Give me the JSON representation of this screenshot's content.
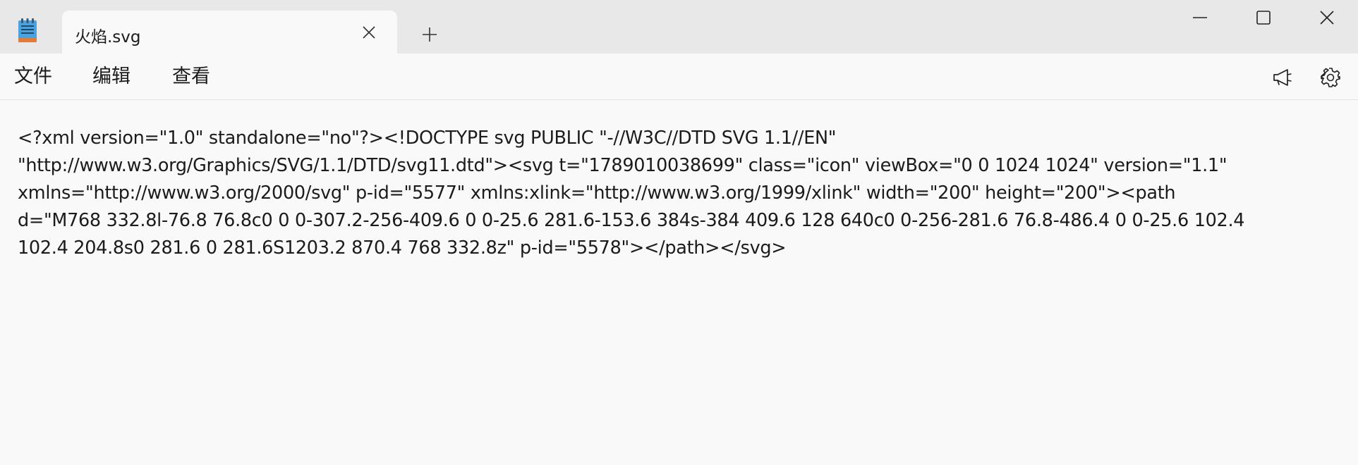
{
  "tab": {
    "title": "火焰.svg"
  },
  "menu": {
    "file": "文件",
    "edit": "编辑",
    "view": "查看"
  },
  "icons": {
    "app": "notepad-icon",
    "close_tab": "close-icon",
    "new_tab": "plus-icon",
    "minimize": "minimize-icon",
    "maximize": "maximize-icon",
    "close_window": "close-icon",
    "announcement": "megaphone-icon",
    "settings": "gear-icon"
  },
  "editor": {
    "lines": [
      "<?xml version=\"1.0\" standalone=\"no\"?><!DOCTYPE svg PUBLIC \"-//W3C//DTD SVG 1.1//EN\"",
      "\"http://www.w3.org/Graphics/SVG/1.1/DTD/svg11.dtd\"><svg t=\"1789010038699\" class=\"icon\" viewBox=\"0 0 1024 1024\" version=\"1.1\"",
      "xmlns=\"http://www.w3.org/2000/svg\" p-id=\"5577\" xmlns:xlink=\"http://www.w3.org/1999/xlink\" width=\"200\" height=\"200\"><path",
      "d=\"M768 332.8l-76.8 76.8c0 0 0-307.2-256-409.6 0 0-25.6 281.6-153.6 384s-384 409.6 128 640c0 0-256-281.6 76.8-486.4 0 0-25.6 102.4",
      "102.4 204.8s0 281.6 0 281.6S1203.2 870.4 768 332.8z\" p-id=\"5578\"></path></svg>"
    ]
  },
  "colors": {
    "titlebar_bg": "#e8e8e8",
    "content_bg": "#f9f9f9",
    "text": "#1b1b1b"
  }
}
